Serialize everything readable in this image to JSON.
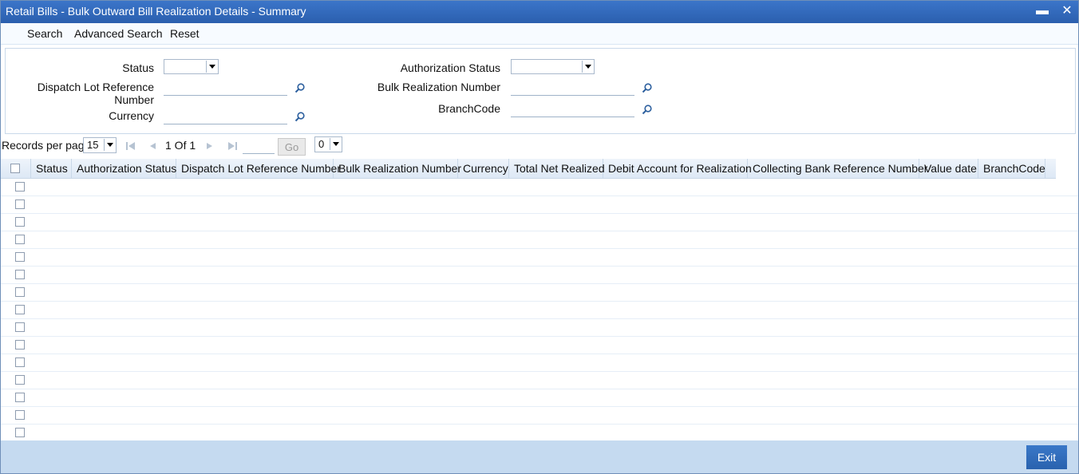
{
  "window": {
    "title": "Retail Bills - Bulk Outward Bill Realization Details - Summary",
    "minimize_glyph": "▬",
    "close_glyph": "✕"
  },
  "menu": {
    "search": "Search",
    "advanced_search": "Advanced Search",
    "reset": "Reset"
  },
  "filters": {
    "status_label": "Status",
    "status_value": "",
    "auth_status_label": "Authorization Status",
    "auth_status_value": "",
    "dispatch_lot_label_1": "Dispatch Lot Reference",
    "dispatch_lot_label_2": "Number",
    "dispatch_lot_value": "",
    "bulk_realization_label": "Bulk Realization Number",
    "bulk_realization_value": "",
    "currency_label": "Currency",
    "currency_value": "",
    "branch_code_label": "BranchCode",
    "branch_code_value": ""
  },
  "pager": {
    "records_label": "Records per page",
    "records_value": "15",
    "page_text": "1 Of 1",
    "goto_value": "",
    "go_label": "Go",
    "right_select_value": "0"
  },
  "grid": {
    "columns": [
      "Status",
      "Authorization Status",
      "Dispatch Lot Reference Number",
      "Bulk Realization Number",
      "Currency",
      "Total Net Realized",
      "Debit Account for Realization",
      "Collecting Bank Reference Number",
      "Value date",
      "BranchCode"
    ],
    "rows": 15
  },
  "footer": {
    "exit_label": "Exit"
  },
  "colors": {
    "titlebar": "#2b5fae",
    "footer": "#c5daf0",
    "accent_button": "#2a62ae"
  }
}
